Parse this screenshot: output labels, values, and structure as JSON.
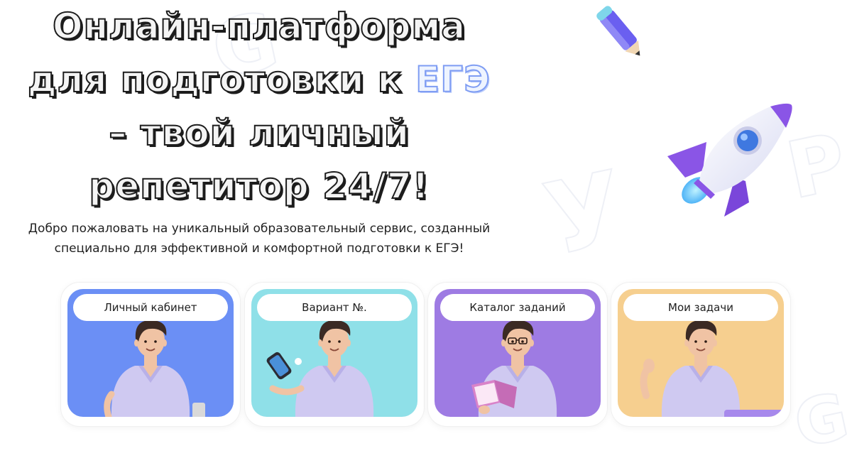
{
  "hero": {
    "title_line1": "Онлайн-платформа",
    "title_line2_prefix": "для подготовки к ",
    "title_line2_highlight": "ЕГЭ",
    "title_line3": "– твой личный",
    "title_line4": "репетитор 24/7!",
    "description_line1": "Добро пожаловать на уникальный образовательный сервис, созданный",
    "description_line2": "специально для эффективной и комфортной подготовки к ЕГЭ!"
  },
  "cards": [
    {
      "label": "Личный кабинет",
      "bg": "#6b8ff5",
      "figure": "student-icon"
    },
    {
      "label": "Вариант №.",
      "bg": "#8fe0e8",
      "figure": "student-with-phone-icon"
    },
    {
      "label": "Каталог заданий",
      "bg": "#9e7be3",
      "figure": "student-with-book-icon"
    },
    {
      "label": "Мои задачи",
      "bg": "#f6cf8f",
      "figure": "student-waving-icon"
    }
  ],
  "decor": {
    "rocket": "rocket-icon",
    "pencil": "pencil-icon"
  },
  "colors": {
    "accent": "#7f9df3",
    "rocket_purple": "#8a55e6",
    "title_stroke": "#1c1c1c"
  }
}
